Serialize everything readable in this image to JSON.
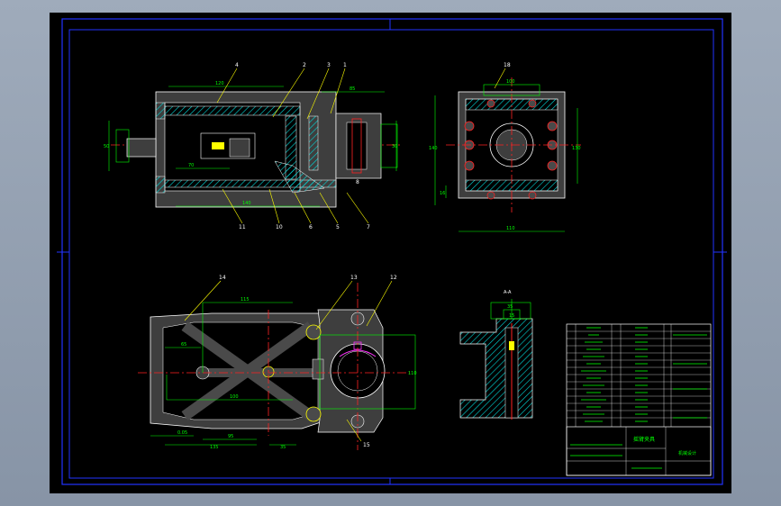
{
  "colors": {
    "background": "#8d9aab",
    "paper": "#000000",
    "frame": "#2233ff",
    "outline": "#ffffff",
    "dimension": "#00ff00",
    "leader": "#ffff00",
    "center": "#ff2222",
    "part": "#4a4a4a",
    "hatch": "#00d8d8",
    "highlight": "#ff33ff"
  },
  "front_view": {
    "balloons": [
      "4",
      "2",
      "3",
      "1",
      "11",
      "10",
      "6",
      "5",
      "7",
      "8"
    ],
    "dims": [
      "120",
      "85",
      "50",
      "30",
      "70",
      "140"
    ]
  },
  "side_view": {
    "balloons": [
      "18"
    ],
    "dims": [
      "100",
      "140",
      "130",
      "110",
      "16"
    ]
  },
  "bottom_view": {
    "balloons": [
      "14",
      "13",
      "12",
      "15"
    ],
    "dims": [
      "115",
      "65",
      "100",
      "135",
      "95",
      "35",
      "110",
      "0.05"
    ]
  },
  "section_view": {
    "label": "A-A",
    "dims": [
      "35",
      "15"
    ]
  },
  "title_block": {
    "drawing_title": "摇臂夹具",
    "company": "机械设计"
  }
}
